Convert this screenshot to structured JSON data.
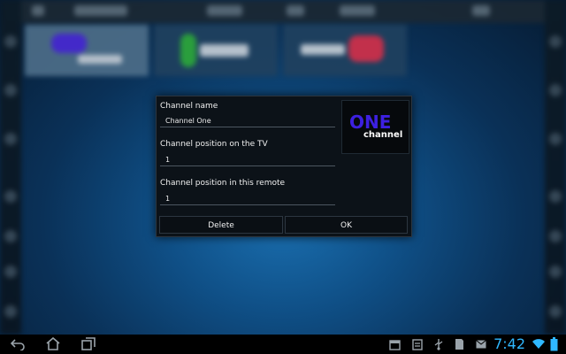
{
  "dialog": {
    "channel_name_label": "Channel name",
    "channel_name_value": "Channel One",
    "tv_position_label": "Channel position on the TV",
    "tv_position_value": "1",
    "remote_position_label": "Channel position in this remote",
    "remote_position_value": "1",
    "logo_top": "ONE",
    "logo_bottom": "channel",
    "delete_label": "Delete",
    "ok_label": "OK"
  },
  "statusbar": {
    "time": "7:42",
    "icons": [
      "back-icon",
      "home-icon",
      "recent-apps-icon",
      "calendar-icon",
      "notes-icon",
      "usb-icon",
      "sd-card-icon",
      "email-icon",
      "wifi-icon",
      "battery-icon"
    ]
  },
  "colors": {
    "logo_one": "#3d20e0",
    "clock": "#2fb8ff",
    "background": "#0f4f86"
  }
}
